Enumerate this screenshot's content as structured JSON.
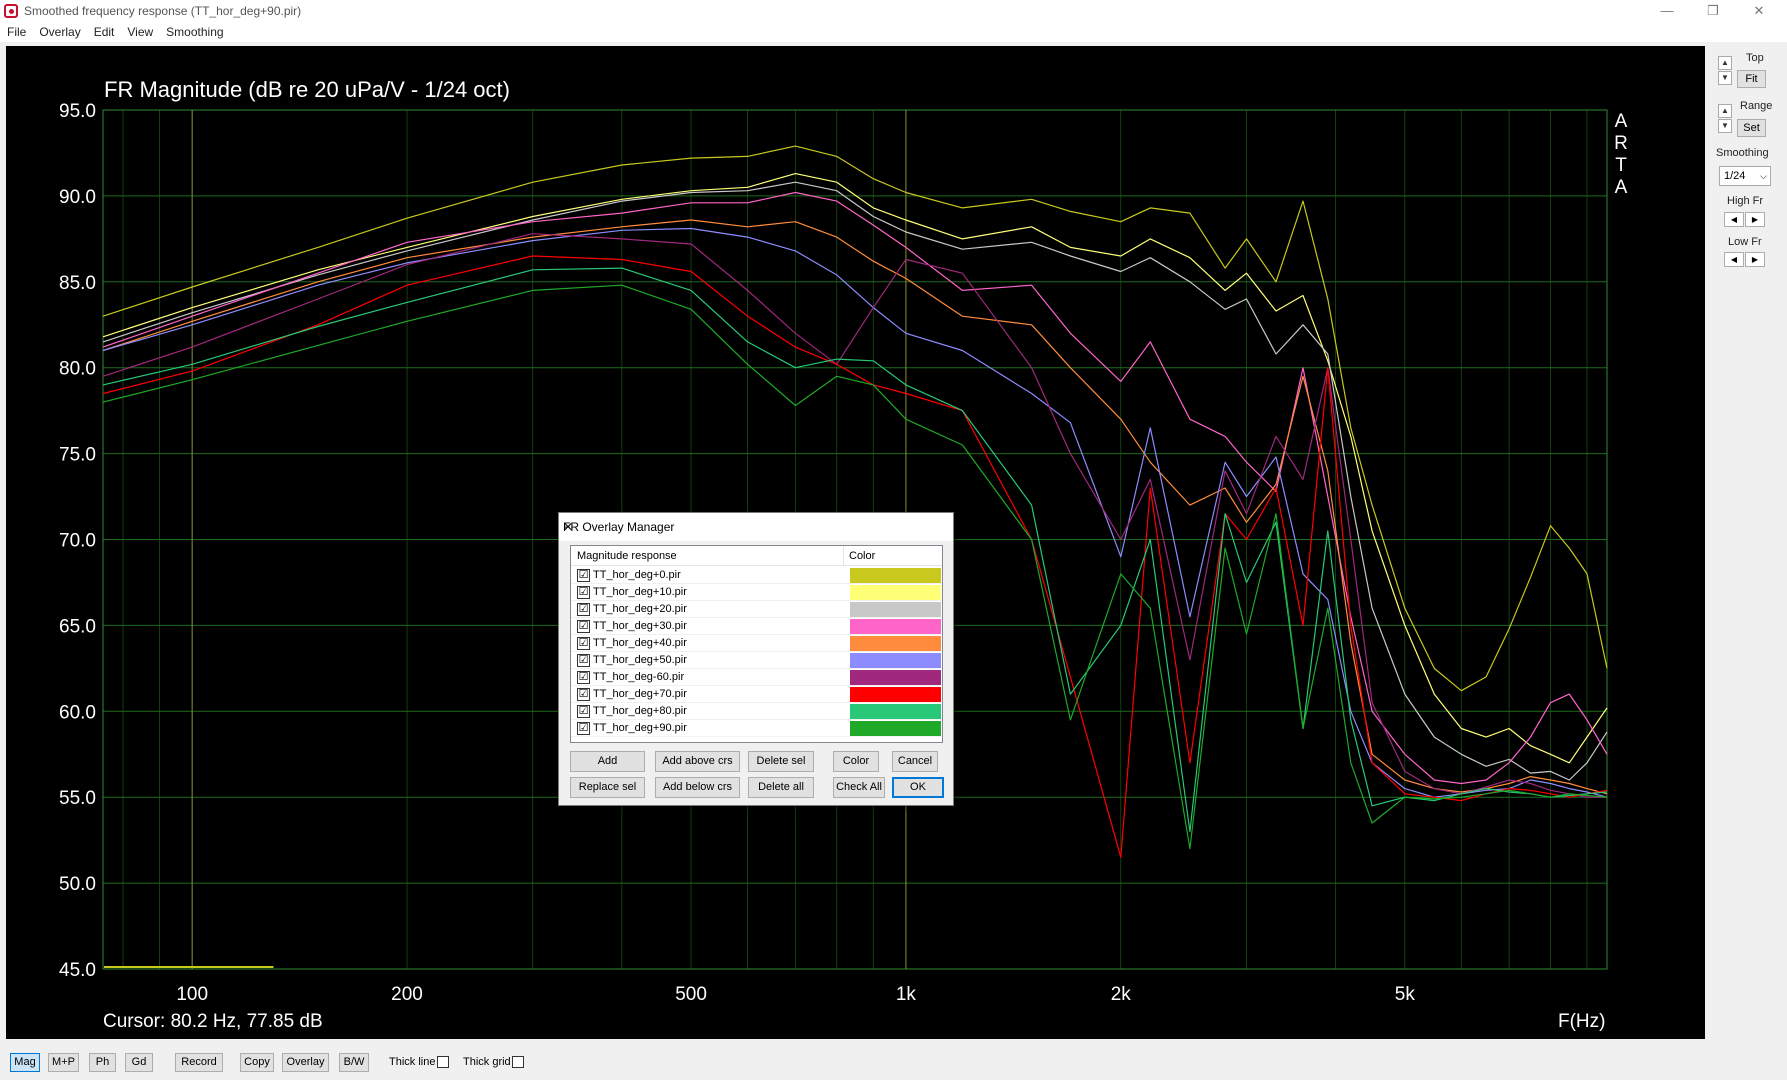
{
  "window": {
    "title": "Smoothed frequency response (TT_hor_deg+90.pir)",
    "min_glyph": "—",
    "max_glyph": "❐",
    "close_glyph": "✕"
  },
  "menu": [
    "File",
    "Overlay",
    "Edit",
    "View",
    "Smoothing"
  ],
  "plot": {
    "title": "FR Magnitude (dB re 20 uPa/V - 1/24 oct)",
    "cursor": "Cursor: 80.2 Hz, 77.85 dB",
    "xlabel": "F(Hz)",
    "watermark": [
      "A",
      "R",
      "T",
      "A"
    ]
  },
  "chart_data": {
    "type": "line",
    "title": "FR Magnitude (dB re 20 uPa/V - 1/24 oct)",
    "xlabel": "F(Hz)",
    "ylabel": "",
    "xscale": "log",
    "xlim": [
      75,
      9600
    ],
    "ylim": [
      45,
      95
    ],
    "x_ticks": [
      100,
      200,
      500,
      1000,
      2000,
      5000
    ],
    "x_tick_labels": [
      "100",
      "200",
      "500",
      "1k",
      "2k",
      "5k"
    ],
    "y_ticks": [
      45,
      50,
      55,
      60,
      65,
      70,
      75,
      80,
      85,
      90,
      95
    ],
    "y_tick_labels": [
      "45.0",
      "50.0",
      "55.0",
      "60.0",
      "65.0",
      "70.0",
      "75.0",
      "80.0",
      "85.0",
      "90.0",
      "95.0"
    ],
    "grid": true,
    "background": "#000000",
    "grid_color": "#1e6b1e",
    "series": [
      {
        "name": "TT_hor_deg+0.pir",
        "color": "#c8c81e",
        "x": [
          75,
          100,
          150,
          200,
          300,
          400,
          500,
          600,
          700,
          800,
          900,
          1000,
          1200,
          1500,
          1700,
          2000,
          2200,
          2500,
          2800,
          3000,
          3300,
          3600,
          3900,
          4200,
          4500,
          5000,
          5500,
          6000,
          6500,
          7000,
          7500,
          8000,
          8500,
          9000,
          9600
        ],
        "y": [
          83,
          84.7,
          87,
          88.7,
          90.8,
          91.8,
          92.2,
          92.3,
          92.9,
          92.3,
          91,
          90.2,
          89.3,
          89.8,
          89.1,
          88.5,
          89.3,
          89,
          85.8,
          87.5,
          85,
          89.7,
          84,
          76.5,
          72,
          66,
          62.5,
          61.2,
          62,
          64.8,
          67.8,
          70.8,
          69.5,
          68,
          62.5
        ]
      },
      {
        "name": "TT_hor_deg+10.pir",
        "color": "#ffff78",
        "x": [
          75,
          100,
          150,
          200,
          300,
          400,
          500,
          600,
          700,
          800,
          900,
          1000,
          1200,
          1500,
          1700,
          2000,
          2200,
          2500,
          2800,
          3000,
          3300,
          3600,
          3900,
          4200,
          4500,
          5000,
          5500,
          6000,
          6500,
          7000,
          7500,
          8000,
          8500,
          9000,
          9600
        ],
        "y": [
          81.8,
          83.5,
          85.7,
          87,
          88.8,
          89.8,
          90.3,
          90.5,
          91.3,
          90.8,
          89.3,
          88.6,
          87.5,
          88.2,
          87,
          86.5,
          87.5,
          86.4,
          84.5,
          85.5,
          83.3,
          84.2,
          80.4,
          76,
          70.5,
          65,
          61,
          59,
          58.5,
          59,
          58,
          57.5,
          57,
          58.5,
          60.2
        ]
      },
      {
        "name": "TT_hor_deg+20.pir",
        "color": "#c8c8c8",
        "x": [
          75,
          100,
          150,
          200,
          300,
          400,
          500,
          600,
          700,
          800,
          900,
          1000,
          1200,
          1500,
          1700,
          2000,
          2200,
          2500,
          2800,
          3000,
          3300,
          3600,
          3900,
          4200,
          4500,
          5000,
          5500,
          6000,
          6500,
          7000,
          7500,
          8000,
          8500,
          9000,
          9600
        ],
        "y": [
          81.5,
          83.2,
          85.4,
          86.8,
          88.6,
          89.7,
          90.2,
          90.3,
          90.8,
          90.3,
          88.8,
          87.9,
          86.9,
          87.3,
          86.5,
          85.6,
          86.4,
          85,
          83.4,
          84,
          80.8,
          82.5,
          80.8,
          72.5,
          66,
          61,
          58.5,
          57.5,
          56.8,
          57.2,
          56.4,
          56.5,
          56,
          57,
          58.8
        ]
      },
      {
        "name": "TT_hor_deg+30.pir",
        "color": "#ff64c8",
        "x": [
          75,
          100,
          150,
          200,
          300,
          400,
          500,
          600,
          700,
          800,
          900,
          1000,
          1200,
          1500,
          1700,
          2000,
          2200,
          2500,
          2800,
          3000,
          3300,
          3600,
          3900,
          4200,
          4500,
          5000,
          5500,
          6000,
          6500,
          7000,
          7500,
          8000,
          8500,
          9000,
          9600
        ],
        "y": [
          81.2,
          83,
          85.5,
          87.3,
          88.5,
          89,
          89.6,
          89.6,
          90.2,
          89.7,
          88.3,
          87,
          84.5,
          84.8,
          82,
          79.2,
          81.5,
          77,
          76,
          74.5,
          72.8,
          80,
          72.5,
          65.5,
          60,
          57.5,
          56,
          55.8,
          56,
          57,
          58.5,
          60.5,
          61,
          59.5,
          57.5
        ]
      },
      {
        "name": "TT_hor_deg+40.pir",
        "color": "#ff8c3c",
        "x": [
          75,
          100,
          150,
          200,
          300,
          400,
          500,
          600,
          700,
          800,
          900,
          1000,
          1200,
          1500,
          1700,
          2000,
          2200,
          2500,
          2800,
          3000,
          3300,
          3600,
          3900,
          4200,
          4500,
          5000,
          5500,
          6000,
          6500,
          7000,
          7500,
          8000,
          8500,
          9000,
          9600
        ],
        "y": [
          81,
          82.7,
          85,
          86.4,
          87.6,
          88.2,
          88.6,
          88.2,
          88.5,
          87.6,
          86.2,
          85.2,
          83,
          82.5,
          80,
          77,
          74.5,
          72,
          73,
          71,
          73.2,
          79.5,
          74,
          64,
          57.5,
          56,
          55.5,
          55.3,
          55.5,
          55.8,
          56.2,
          56,
          55.8,
          55.5,
          55.2
        ]
      },
      {
        "name": "TT_hor_deg+50.pir",
        "color": "#8c8cff",
        "x": [
          75,
          100,
          150,
          200,
          300,
          400,
          500,
          600,
          700,
          800,
          900,
          1000,
          1200,
          1500,
          1700,
          2000,
          2200,
          2500,
          2800,
          3000,
          3300,
          3600,
          3900,
          4200,
          4500,
          5000,
          5500,
          6000,
          6500,
          7000,
          7500,
          8000,
          8500,
          9000,
          9600
        ],
        "y": [
          81,
          82.5,
          84.8,
          86.1,
          87.4,
          88,
          88.1,
          87.6,
          86.8,
          85.4,
          83.5,
          82,
          81,
          78.5,
          76.8,
          69,
          76.5,
          65.5,
          74.5,
          72.5,
          74.8,
          68,
          66.5,
          60,
          57,
          55.5,
          55,
          55.2,
          55.4,
          55.5,
          56,
          55.8,
          55.5,
          55.3,
          55
        ]
      },
      {
        "name": "TT_hor_deg-60.pir",
        "color": "#a0287d",
        "x": [
          75,
          100,
          150,
          200,
          300,
          400,
          500,
          600,
          700,
          800,
          900,
          1000,
          1200,
          1500,
          1700,
          2000,
          2200,
          2500,
          2800,
          3000,
          3300,
          3600,
          3900,
          4200,
          4500,
          5000,
          5500,
          6000,
          6500,
          7000,
          7500,
          8000,
          8500,
          9000,
          9600
        ],
        "y": [
          79.5,
          81.2,
          84,
          86,
          87.8,
          87.5,
          87.2,
          84.5,
          82,
          80.2,
          83.5,
          86.3,
          85.5,
          80,
          75,
          70,
          73.5,
          63,
          74,
          71.5,
          76,
          73.5,
          80,
          70,
          60.5,
          56.5,
          55.5,
          55.2,
          55.6,
          56,
          55.8,
          55.4,
          55.2,
          55,
          55
        ]
      },
      {
        "name": "TT_hor_deg+70.pir",
        "color": "#ff0000",
        "x": [
          75,
          100,
          150,
          200,
          300,
          400,
          500,
          600,
          700,
          800,
          900,
          1000,
          1200,
          1500,
          1700,
          2000,
          2200,
          2500,
          2800,
          3000,
          3300,
          3600,
          3900,
          4200,
          4500,
          5000,
          5500,
          6000,
          6500,
          7000,
          7500,
          8000,
          8500,
          9000,
          9600
        ],
        "y": [
          78.5,
          79.8,
          82.5,
          84.8,
          86.5,
          86.3,
          85.6,
          83,
          81.2,
          80.2,
          79,
          78.5,
          77.5,
          70,
          62,
          51.5,
          73,
          57,
          71.5,
          70,
          73,
          65,
          80,
          65,
          57,
          55.2,
          55,
          54.8,
          55.2,
          55.5,
          55.4,
          55.2,
          55,
          55.2,
          55.4
        ]
      },
      {
        "name": "TT_hor_deg+80.pir",
        "color": "#28c878",
        "x": [
          75,
          100,
          150,
          200,
          300,
          400,
          500,
          600,
          700,
          800,
          900,
          1000,
          1200,
          1500,
          1700,
          2000,
          2200,
          2500,
          2800,
          3000,
          3300,
          3600,
          3900,
          4200,
          4500,
          5000,
          5500,
          6000,
          6500,
          7000,
          7500,
          8000,
          8500,
          9000,
          9600
        ],
        "y": [
          79,
          80.2,
          82.4,
          83.8,
          85.7,
          85.8,
          84.5,
          81.5,
          80,
          80.5,
          80.4,
          79,
          77.5,
          72,
          61,
          65,
          70,
          53,
          71.5,
          67.5,
          71,
          59,
          70.5,
          59.5,
          54.5,
          55,
          54.8,
          55.2,
          55.5,
          55.3,
          55.2,
          55,
          55.1,
          55.2,
          55.3
        ]
      },
      {
        "name": "TT_hor_deg+90.pir",
        "color": "#1eaa28",
        "x": [
          75,
          100,
          150,
          200,
          300,
          400,
          500,
          600,
          700,
          800,
          900,
          1000,
          1200,
          1500,
          1700,
          2000,
          2200,
          2500,
          2800,
          3000,
          3300,
          3600,
          3900,
          4200,
          4500,
          5000,
          5500,
          6000,
          6500,
          7000,
          7500,
          8000,
          8500,
          9000,
          9600
        ],
        "y": [
          78,
          79.3,
          81.3,
          82.7,
          84.5,
          84.8,
          83.4,
          80.2,
          77.8,
          79.5,
          79,
          77,
          75.5,
          70,
          59.5,
          68,
          66,
          52,
          69.5,
          64.5,
          71.5,
          59,
          66,
          57,
          53.5,
          55,
          54.9,
          55,
          55.2,
          55.4,
          55.2,
          55,
          55.2,
          55.1,
          55
        ]
      }
    ]
  },
  "right_panel": {
    "top_label": "Top",
    "fit_label": "Fit",
    "range_label": "Range",
    "set_label": "Set",
    "smoothing_label": "Smoothing",
    "smoothing_value": "1/24",
    "high_fr_label": "High Fr",
    "low_fr_label": "Low Fr"
  },
  "bottom_toolbar": {
    "buttons": [
      "Mag",
      "M+P",
      "Ph",
      "Gd",
      "Record",
      "Copy",
      "Overlay",
      "B/W"
    ],
    "active": "Mag",
    "thick_line_label": "Thick line",
    "thick_grid_label": "Thick grid"
  },
  "dialog": {
    "title": "FR Overlay Manager",
    "col_response": "Magnitude response",
    "col_color": "Color",
    "rows": [
      {
        "name": "TT_hor_deg+0.pir",
        "checked": "☑",
        "color": "#c8c81e"
      },
      {
        "name": "TT_hor_deg+10.pir",
        "checked": "☑",
        "color": "#ffff78"
      },
      {
        "name": "TT_hor_deg+20.pir",
        "checked": "☑",
        "color": "#c8c8c8"
      },
      {
        "name": "TT_hor_deg+30.pir",
        "checked": "☑",
        "color": "#ff64c8"
      },
      {
        "name": "TT_hor_deg+40.pir",
        "checked": "☑",
        "color": "#ff8c3c"
      },
      {
        "name": "TT_hor_deg+50.pir",
        "checked": "☑",
        "color": "#8c8cff"
      },
      {
        "name": "TT_hor_deg-60.pir",
        "checked": "☑",
        "color": "#a0287d"
      },
      {
        "name": "TT_hor_deg+70.pir",
        "checked": "☑",
        "color": "#ff0000"
      },
      {
        "name": "TT_hor_deg+80.pir",
        "checked": "☑",
        "color": "#28c878"
      },
      {
        "name": "TT_hor_deg+90.pir",
        "checked": "☑",
        "color": "#1eaa28"
      }
    ],
    "buttons": {
      "add": "Add",
      "add_above": "Add above crs",
      "delete_sel": "Delete sel",
      "color": "Color",
      "cancel": "Cancel",
      "replace_sel": "Replace sel",
      "add_below": "Add below crs",
      "delete_all": "Delete all",
      "check_all": "Check All",
      "ok": "OK"
    }
  }
}
